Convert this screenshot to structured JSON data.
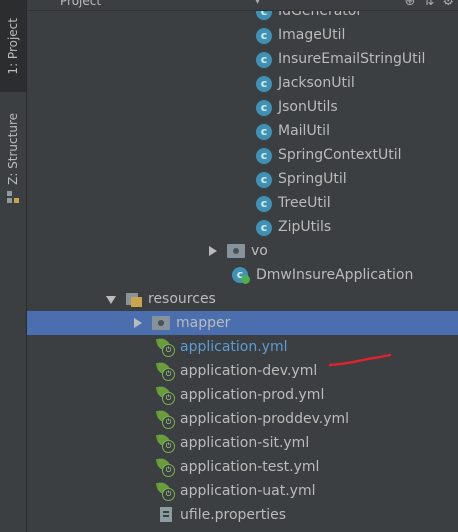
{
  "sidebar": {
    "project_tab": "1: Project",
    "structure_tab": "Z: Structure"
  },
  "header": {
    "title": "Project",
    "caret": "▾",
    "icons": [
      "add-icon",
      "collapse-icon",
      "settings-icon"
    ]
  },
  "tree": {
    "util_classes": [
      {
        "label": "IdGenerator"
      },
      {
        "label": "ImageUtil"
      },
      {
        "label": "InsureEmailStringUtil"
      },
      {
        "label": "JacksonUtil"
      },
      {
        "label": "JsonUtils"
      },
      {
        "label": "MailUtil"
      },
      {
        "label": "SpringContextUtil"
      },
      {
        "label": "SpringUtil"
      },
      {
        "label": "TreeUtil"
      },
      {
        "label": "ZipUtils"
      }
    ],
    "vo_folder": "vo",
    "main_app": "DmwInsureApplication",
    "resources_folder": "resources",
    "mapper_folder": "mapper",
    "yml_files": [
      {
        "label": "application.yml"
      },
      {
        "label": "application-dev.yml"
      },
      {
        "label": "application-prod.yml"
      },
      {
        "label": "application-proddev.yml"
      },
      {
        "label": "application-sit.yml"
      },
      {
        "label": "application-test.yml"
      },
      {
        "label": "application-uat.yml"
      }
    ],
    "properties_file": "ufile.properties"
  },
  "annotation": {
    "color": "#e8202a"
  }
}
